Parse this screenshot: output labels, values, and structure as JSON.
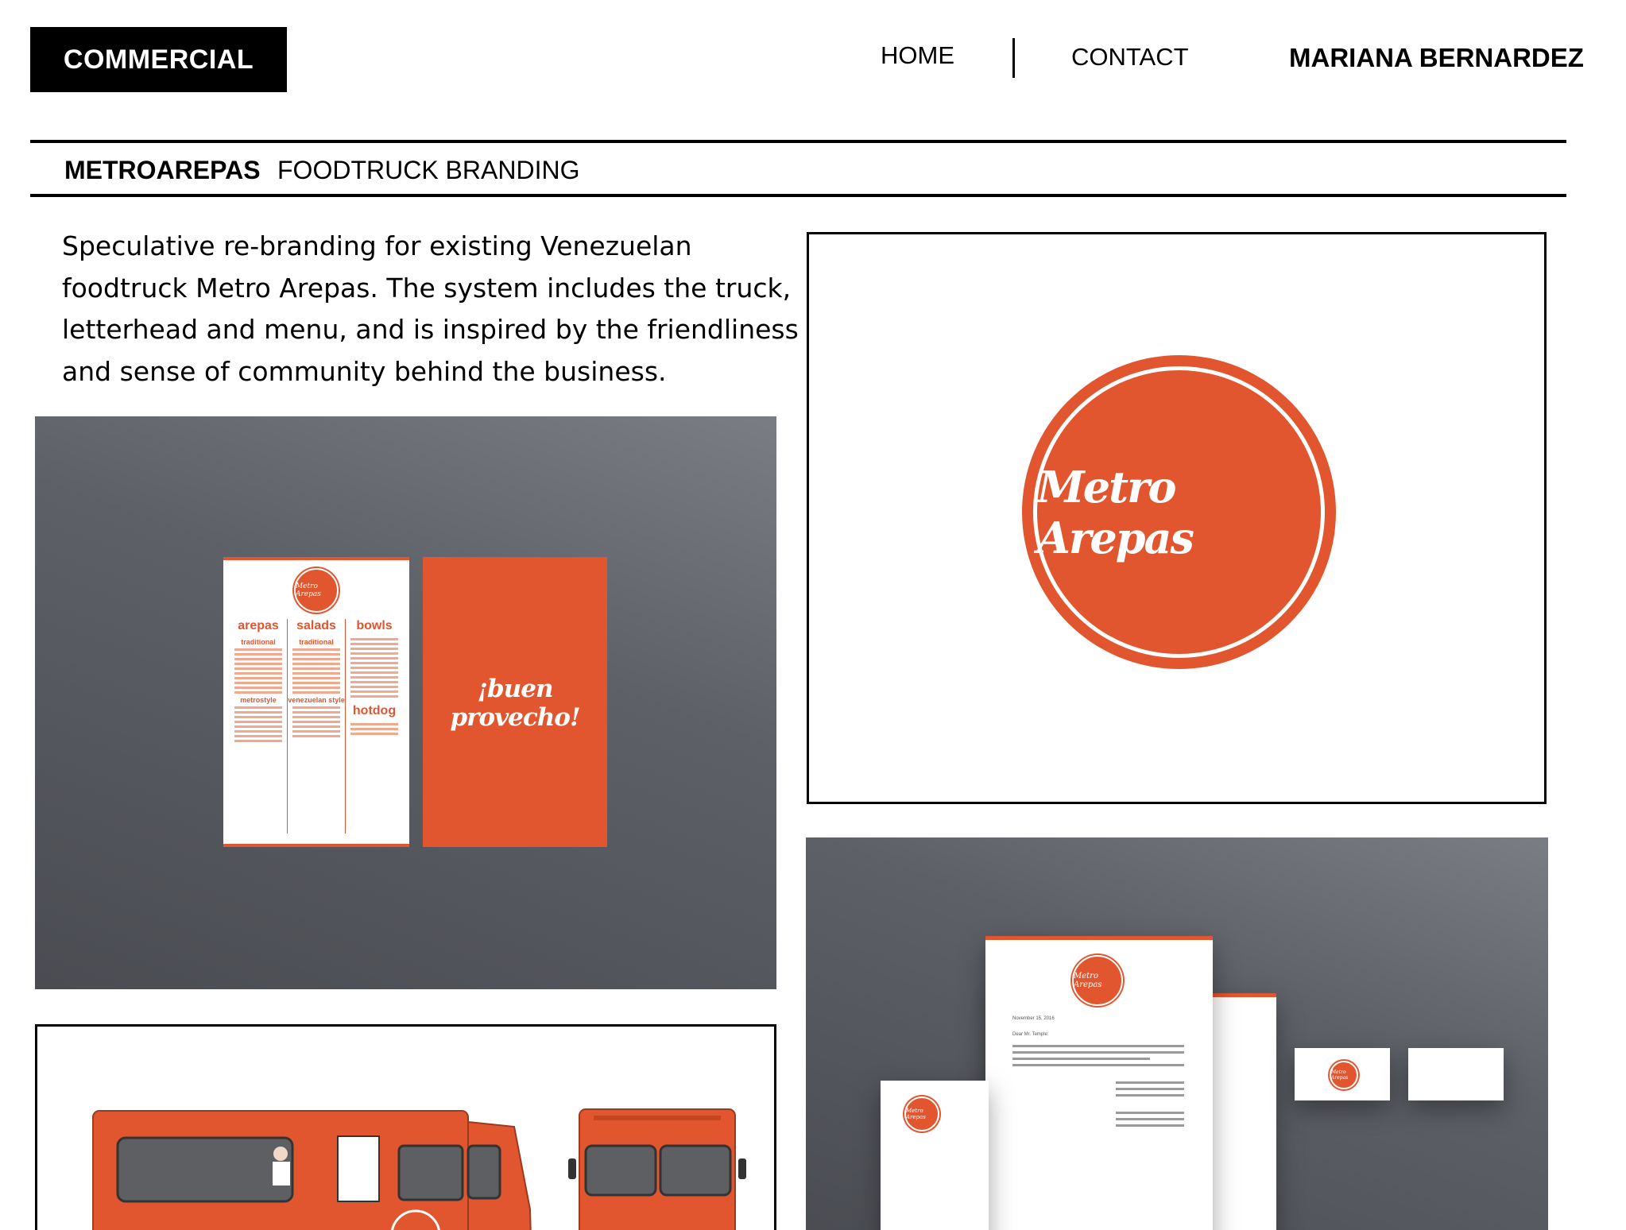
{
  "header": {
    "section_label": "COMMERCIAL",
    "nav": {
      "home": "HOME",
      "contact": "CONTACT"
    },
    "author": "MARIANA BERNARDEZ"
  },
  "project": {
    "title": "METROAREPAS",
    "subtitle": "FOODTRUCK BRANDING",
    "description": "Speculative re-branding for existing Venezuelan foodtruck Metro Arepas. The system includes the truck, letterhead and menu, and is inspired by the friendliness and sense of community behind the business."
  },
  "menu_mockup": {
    "brand": "Metro Arepas",
    "columns": [
      {
        "heading": "arepas",
        "subs": [
          "traditional",
          "metrostyle"
        ]
      },
      {
        "heading": "salads",
        "subs": [
          "traditional",
          "venezuelan style"
        ]
      },
      {
        "heading": "bowls",
        "subs": [
          "hotdog"
        ]
      }
    ],
    "back_text": "¡buen provecho!"
  },
  "logo": {
    "text": "Metro Arepas"
  },
  "letterhead": {
    "brand": "Metro Arepas",
    "date": "November 15, 2016",
    "salutation": "Dear Mr. Temple:"
  },
  "colors": {
    "brand_orange": "#e2562f",
    "panel_dark": "#55575d"
  }
}
